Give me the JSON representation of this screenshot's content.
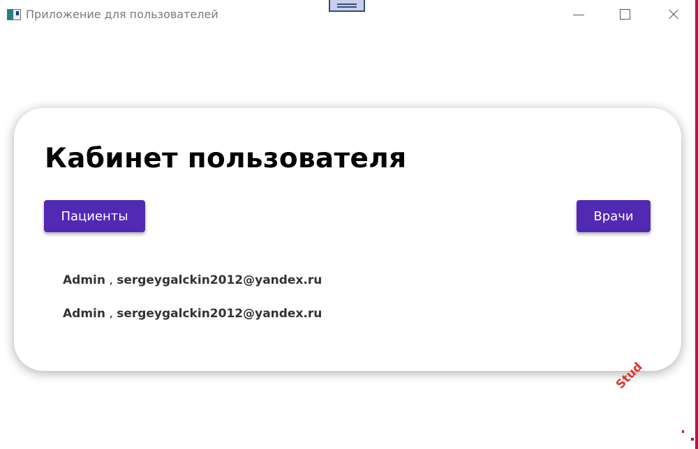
{
  "window": {
    "title": "Приложение для пользователей"
  },
  "page": {
    "title": "Кабинет пользователя",
    "patients_button": "Пациенты",
    "doctors_button": "Врачи"
  },
  "users": [
    {
      "role": "Admin",
      "separator": ",",
      "email": "sergeygalckin2012@yandex.ru"
    },
    {
      "role": "Admin",
      "separator": ",",
      "email": "sergeygalckin2012@yandex.ru"
    }
  ],
  "watermark": {
    "text": "Stud"
  },
  "colors": {
    "button": "#5129b3",
    "window_edge": "#b5174f",
    "watermark": "#e5322d"
  }
}
